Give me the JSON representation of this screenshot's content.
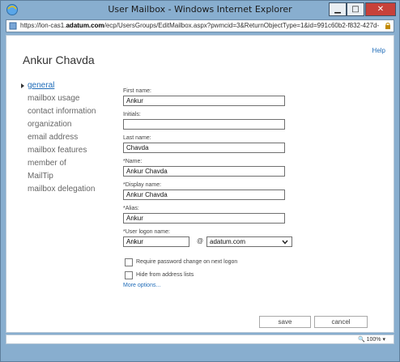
{
  "window": {
    "title": "User Mailbox - Windows Internet Explorer",
    "url_prefix": "https://lon-cas1.",
    "url_host": "adatum.com",
    "url_path": "/ecp/UsersGroups/EditMailbox.aspx?pwmcid=3&ReturnObjectType=1&id=991c60b2-f832-427d-"
  },
  "header": {
    "help_label": "Help",
    "title": "Ankur Chavda"
  },
  "nav": {
    "items": [
      {
        "label": "general"
      },
      {
        "label": "mailbox usage"
      },
      {
        "label": "contact information"
      },
      {
        "label": "organization"
      },
      {
        "label": "email address"
      },
      {
        "label": "mailbox features"
      },
      {
        "label": "member of"
      },
      {
        "label": "MailTip"
      },
      {
        "label": "mailbox delegation"
      }
    ]
  },
  "form": {
    "first_name": {
      "label": "First name:",
      "value": "Ankur"
    },
    "initials": {
      "label": "Initials:",
      "value": ""
    },
    "last_name": {
      "label": "Last name:",
      "value": "Chavda"
    },
    "name": {
      "label": "*Name:",
      "value": "Ankur Chavda"
    },
    "display_name": {
      "label": "*Display name:",
      "value": "Ankur Chavda"
    },
    "alias": {
      "label": "*Alias:",
      "value": "Ankur"
    },
    "user_logon": {
      "label": "*User logon name:",
      "value": "Ankur",
      "at": "@",
      "domain": "adatum.com"
    },
    "require_password_change": {
      "label": "Require password change on next logon",
      "checked": false
    },
    "hide_from_address_lists": {
      "label": "Hide from address lists",
      "checked": false
    },
    "more_options": "More options..."
  },
  "buttons": {
    "save": "save",
    "cancel": "cancel"
  },
  "status": {
    "zoom": "100%"
  },
  "colors": {
    "link_blue": "#1e6bb8",
    "window_frame": "#88aecf",
    "close_red": "#c7413a"
  },
  "icons": [
    "ie-logo-icon",
    "minimize-icon",
    "maximize-icon",
    "close-icon",
    "page-icon",
    "lock-icon",
    "chevron-down-icon",
    "zoom-icon"
  ]
}
